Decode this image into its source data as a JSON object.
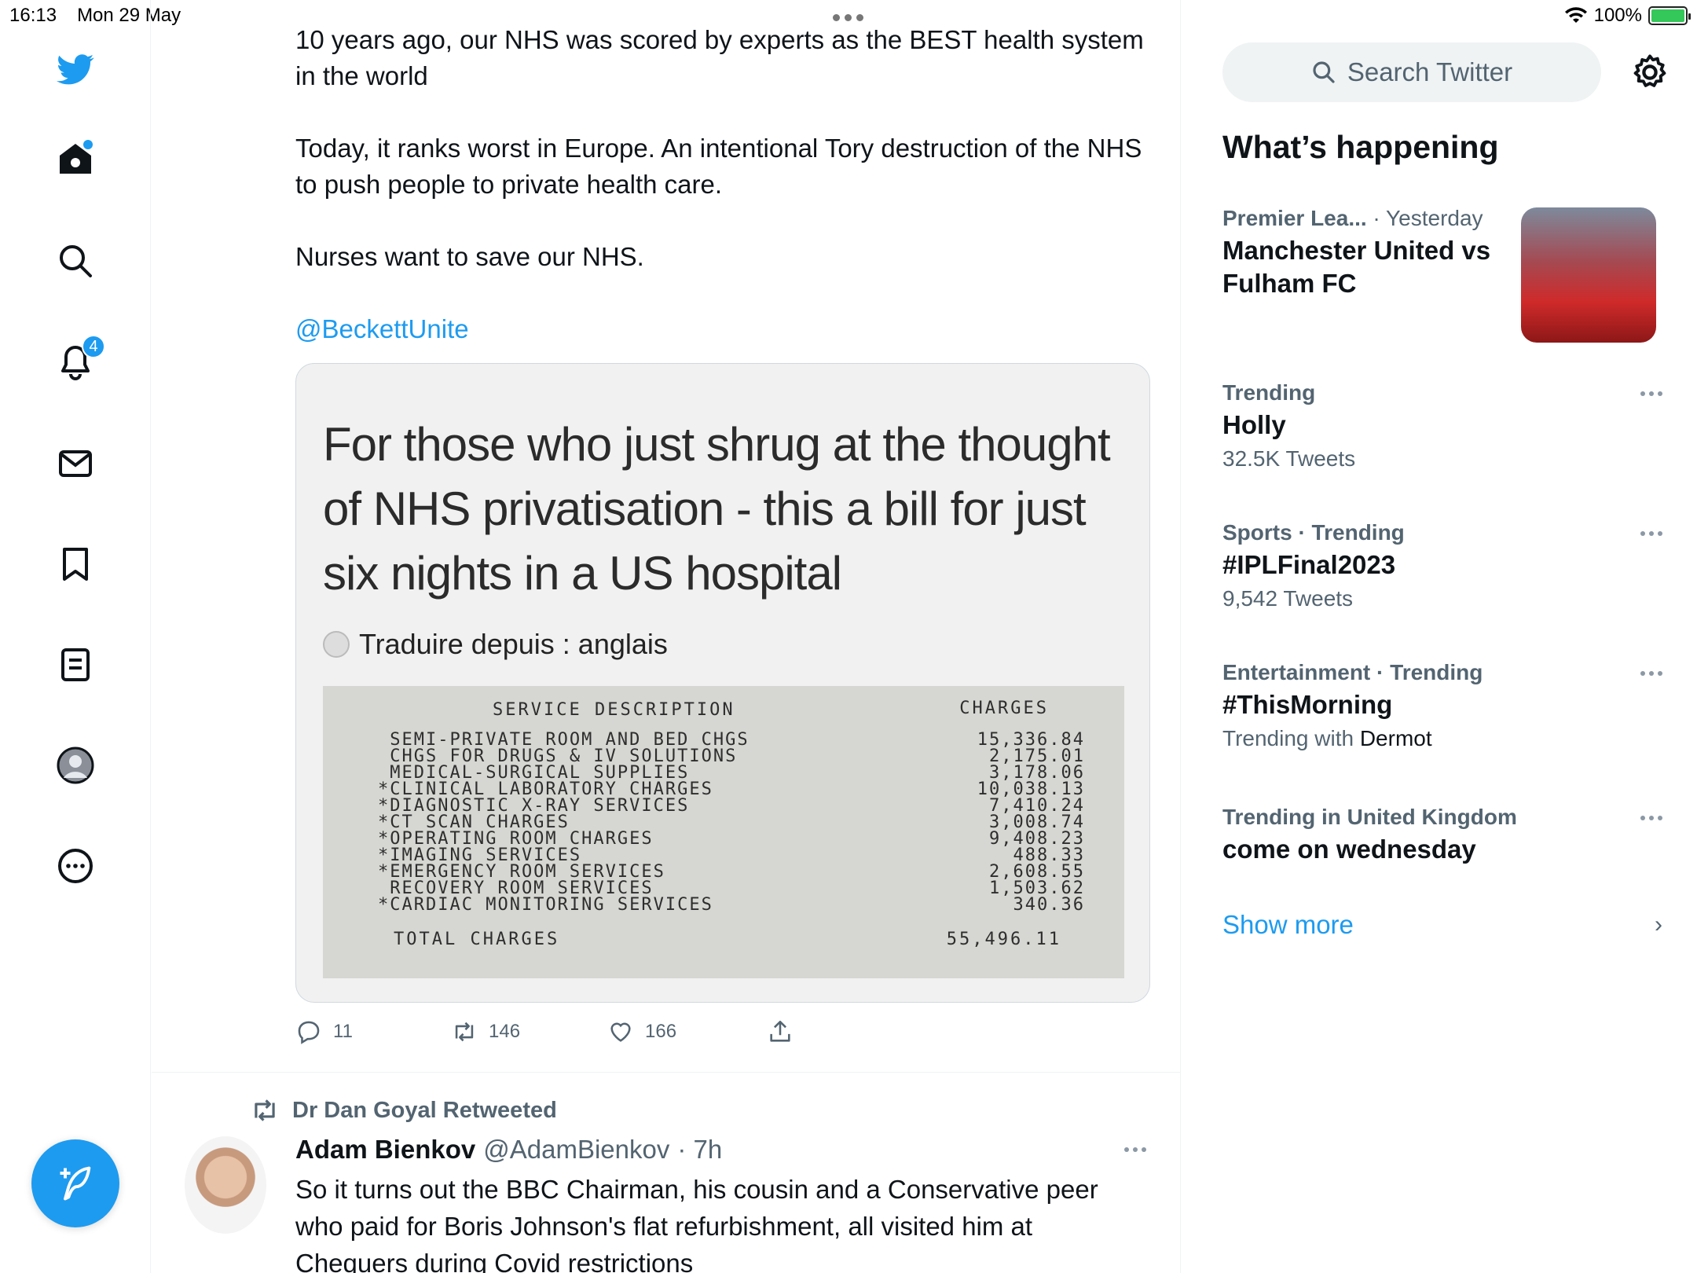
{
  "status_bar": {
    "time": "16:13",
    "date": "Mon 29 May",
    "battery": "100%"
  },
  "nav": {
    "notifications_count": "4"
  },
  "tweet1": {
    "paragraphs": [
      "10 years ago, our NHS was scored by experts as the BEST health system in the world",
      "Today, it ranks worst in Europe.  An intentional Tory destruction of the NHS to push people to private health care.",
      "Nurses want to save our NHS."
    ],
    "mention": "@BeckettUnite",
    "media": {
      "heading": "For those who just shrug at the thought of NHS privatisation - this a bill for just six nights in a US hospital",
      "translate": "Traduire depuis : anglais",
      "bill": {
        "col_desc": "SERVICE DESCRIPTION",
        "col_charges": "CHARGES",
        "rows": [
          {
            "desc": " SEMI-PRIVATE ROOM AND BED CHGS",
            "amt": "15,336.84"
          },
          {
            "desc": " CHGS FOR DRUGS & IV SOLUTIONS",
            "amt": "2,175.01"
          },
          {
            "desc": " MEDICAL-SURGICAL SUPPLIES",
            "amt": "3,178.06"
          },
          {
            "desc": "*CLINICAL LABORATORY CHARGES",
            "amt": "10,038.13"
          },
          {
            "desc": "*DIAGNOSTIC X-RAY SERVICES",
            "amt": "7,410.24"
          },
          {
            "desc": "*CT SCAN CHARGES",
            "amt": "3,008.74"
          },
          {
            "desc": "*OPERATING ROOM CHARGES",
            "amt": "9,408.23"
          },
          {
            "desc": "*IMAGING SERVICES",
            "amt": "488.33"
          },
          {
            "desc": "*EMERGENCY ROOM SERVICES",
            "amt": "2,608.55"
          },
          {
            "desc": " RECOVERY ROOM SERVICES",
            "amt": "1,503.62"
          },
          {
            "desc": "*CARDIAC MONITORING SERVICES",
            "amt": "340.36"
          }
        ],
        "total_label": "TOTAL CHARGES",
        "total_amount": "55,496.11"
      }
    },
    "actions": {
      "replies": "11",
      "retweets": "146",
      "likes": "166"
    }
  },
  "tweet2": {
    "retweeted_by": "Dr Dan Goyal Retweeted",
    "name": "Adam Bienkov",
    "handle": "@AdamBienkov",
    "time": "· 7h",
    "text": "So it turns out the BBC Chairman, his cousin and a Conservative peer who paid for Boris Johnson's flat refurbishment, all visited him at Chequers during Covid restrictions"
  },
  "sidebar": {
    "search_placeholder": "Search Twitter",
    "whats_happening": "What’s happening",
    "trends": [
      {
        "meta": "Premier Lea...",
        "meta2": " · Yesterday",
        "title": "Manchester United vs Fulham FC",
        "sub": "",
        "sub_dark": ""
      },
      {
        "meta": "Trending",
        "meta2": "",
        "title": "Holly",
        "sub": "32.5K Tweets",
        "sub_dark": ""
      },
      {
        "meta": "Sports · Trending",
        "meta2": "",
        "title": "#IPLFinal2023",
        "sub": "9,542 Tweets",
        "sub_dark": ""
      },
      {
        "meta": "Entertainment · Trending",
        "meta2": "",
        "title": "#ThisMorning",
        "sub": "Trending with ",
        "sub_dark": "Dermot"
      },
      {
        "meta": "Trending in United Kingdom",
        "meta2": "",
        "title": "come on wednesday",
        "sub": "",
        "sub_dark": ""
      }
    ],
    "show_more": "Show more"
  },
  "colors": {
    "accent": "#1d9bf0",
    "muted": "#536471",
    "text": "#0f1419"
  }
}
